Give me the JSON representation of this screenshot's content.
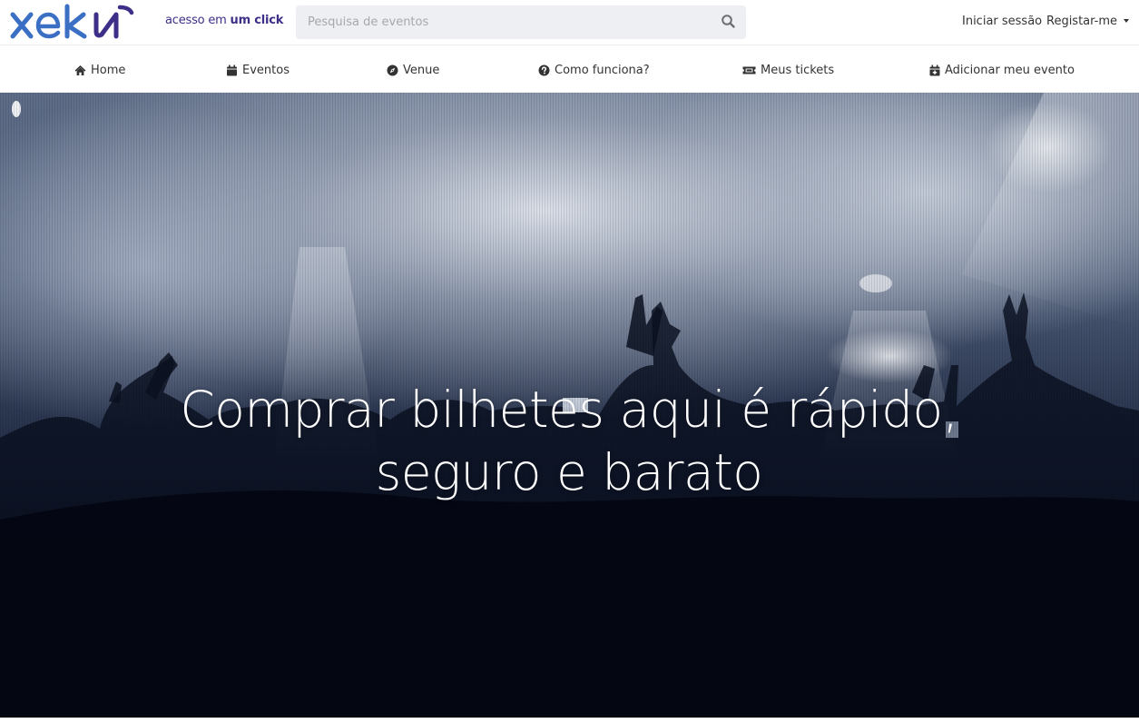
{
  "brand": {
    "logo_text": "xeki",
    "tagline_normal": "acesso em ",
    "tagline_bold": "um click",
    "logo_color": "#3b6fc4",
    "tagline_color": "#3d2f88"
  },
  "search": {
    "placeholder": "Pesquisa de eventos",
    "icon": "search-icon"
  },
  "account": {
    "login_label": "Iniciar sessão",
    "register_label": "Registar-me"
  },
  "nav": {
    "items": [
      {
        "label": "Home",
        "icon": "home-icon"
      },
      {
        "label": "Eventos",
        "icon": "calendar-icon"
      },
      {
        "label": "Venue",
        "icon": "compass-icon"
      },
      {
        "label": "Como funciona?",
        "icon": "question-circle-icon"
      },
      {
        "label": "Meus tickets",
        "icon": "ticket-icon"
      },
      {
        "label": "Adicionar meu evento",
        "icon": "calendar-plus-icon"
      }
    ]
  },
  "hero": {
    "line1": "Comprar bilhetes aqui é rápido,",
    "line2": "seguro e barato",
    "background": "concert-crowd-image"
  }
}
